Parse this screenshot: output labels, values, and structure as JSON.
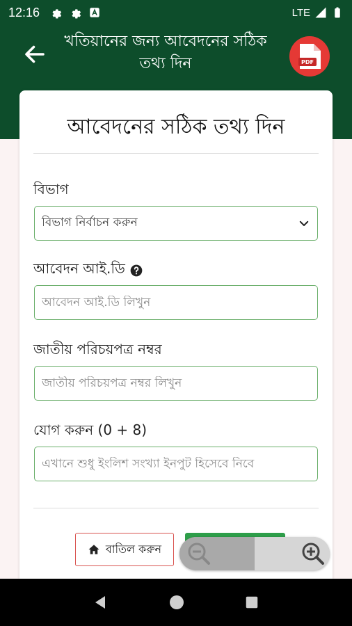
{
  "status_bar": {
    "time": "12:16",
    "network": "LTE"
  },
  "app_bar": {
    "title": "খতিয়ানের জন্য আবেদনের সঠিক তথ্য দিন",
    "pdf_badge": "PDF"
  },
  "form": {
    "heading": "আবেদনের সঠিক তথ্য দিন",
    "division_label": "বিভাগ",
    "division_value": "বিভাগ নির্বাচন করুন",
    "application_id_label": "আবেদন আই.ডি",
    "application_id_placeholder": "আবেদন আই.ডি লিখুন",
    "nid_label": "জাতীয় পরিচয়পত্র নম্বর",
    "nid_placeholder": "জাতীয় পরিচয়পত্র নম্বর লিখুন",
    "captcha_label": "যোগ করুন (0 + 8)",
    "captcha_placeholder": "এখানে শুধু ইংলিশ সংখ্যা ইনপুট হিসেবে নিবে",
    "cancel_label": "বাতিল করুন"
  },
  "colors": {
    "primary": "#0d4d2b",
    "field_border": "#6aae6a",
    "cancel_border": "#d9534f",
    "submit": "#2e9e4a",
    "pdf": "#e53935"
  }
}
